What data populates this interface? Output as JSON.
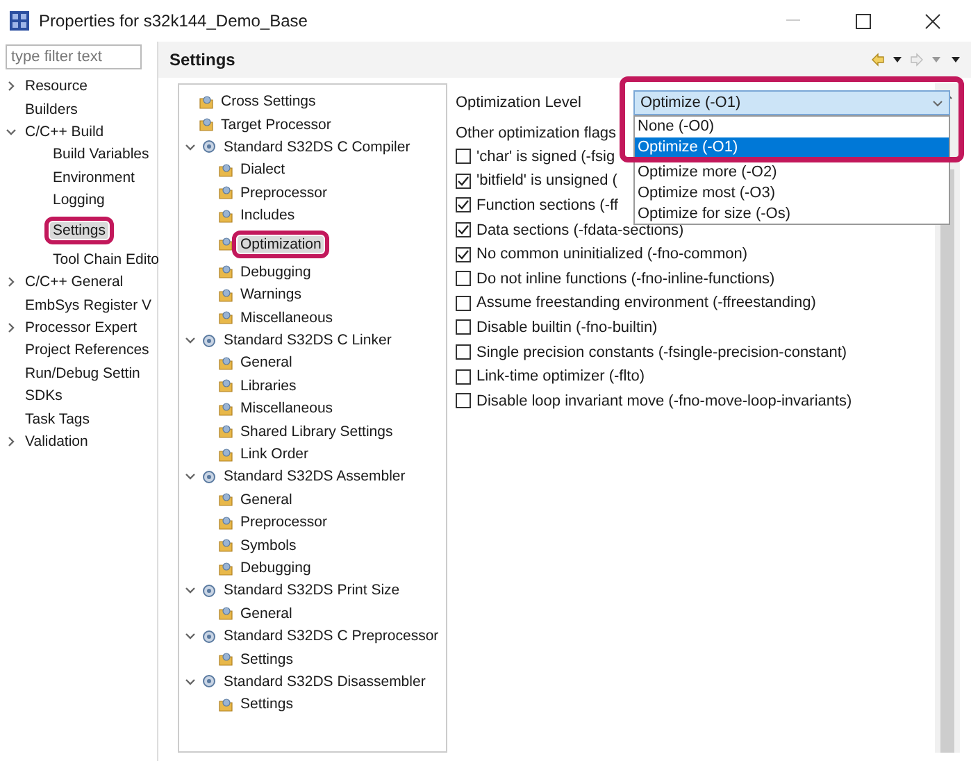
{
  "window": {
    "title": "Properties for s32k144_Demo_Base"
  },
  "filter": {
    "placeholder": "type filter text"
  },
  "sidebar": {
    "items": [
      {
        "label": "Resource",
        "expanded": false,
        "selected": false,
        "annotated": false
      },
      {
        "label": "Builders",
        "selected": false,
        "annotated": false
      },
      {
        "label": "C/C++ Build",
        "expanded": true,
        "selected": false,
        "annotated": false,
        "children": [
          {
            "label": "Build Variables",
            "selected": false,
            "annotated": false
          },
          {
            "label": "Environment",
            "selected": false,
            "annotated": false
          },
          {
            "label": "Logging",
            "selected": false,
            "annotated": false
          },
          {
            "label": "Settings",
            "selected": true,
            "annotated": true
          },
          {
            "label": "Tool Chain Edito",
            "selected": false,
            "annotated": false
          }
        ]
      },
      {
        "label": "C/C++ General",
        "expanded": false,
        "selected": false,
        "annotated": false
      },
      {
        "label": "EmbSys Register V",
        "selected": false,
        "annotated": false
      },
      {
        "label": "Processor Expert",
        "expanded": false,
        "selected": false,
        "annotated": false
      },
      {
        "label": "Project References",
        "selected": false,
        "annotated": false
      },
      {
        "label": "Run/Debug Settin",
        "selected": false,
        "annotated": false
      },
      {
        "label": "SDKs",
        "selected": false,
        "annotated": false
      },
      {
        "label": "Task Tags",
        "selected": false,
        "annotated": false
      },
      {
        "label": "Validation",
        "expanded": false,
        "selected": false,
        "annotated": false
      }
    ]
  },
  "page": {
    "title": "Settings"
  },
  "tool_tree": [
    {
      "label": "Cross Settings",
      "kind": "page",
      "selected": false,
      "annotated": false
    },
    {
      "label": "Target Processor",
      "kind": "page",
      "selected": false,
      "annotated": false
    },
    {
      "label": "Standard S32DS C Compiler",
      "kind": "tool",
      "expanded": true,
      "children": [
        {
          "label": "Dialect",
          "kind": "page",
          "selected": false,
          "annotated": false
        },
        {
          "label": "Preprocessor",
          "kind": "page",
          "selected": false,
          "annotated": false
        },
        {
          "label": "Includes",
          "kind": "page",
          "selected": false,
          "annotated": false
        },
        {
          "label": "Optimization",
          "kind": "page",
          "selected": true,
          "annotated": true
        },
        {
          "label": "Debugging",
          "kind": "page",
          "selected": false,
          "annotated": false
        },
        {
          "label": "Warnings",
          "kind": "page",
          "selected": false,
          "annotated": false
        },
        {
          "label": "Miscellaneous",
          "kind": "page",
          "selected": false,
          "annotated": false
        }
      ]
    },
    {
      "label": "Standard S32DS C Linker",
      "kind": "tool",
      "expanded": true,
      "children": [
        {
          "label": "General",
          "kind": "page",
          "selected": false,
          "annotated": false
        },
        {
          "label": "Libraries",
          "kind": "page",
          "selected": false,
          "annotated": false
        },
        {
          "label": "Miscellaneous",
          "kind": "page",
          "selected": false,
          "annotated": false
        },
        {
          "label": "Shared Library Settings",
          "kind": "page",
          "selected": false,
          "annotated": false
        },
        {
          "label": "Link Order",
          "kind": "page",
          "selected": false,
          "annotated": false
        }
      ]
    },
    {
      "label": "Standard S32DS Assembler",
      "kind": "tool",
      "expanded": true,
      "children": [
        {
          "label": "General",
          "kind": "page",
          "selected": false,
          "annotated": false
        },
        {
          "label": "Preprocessor",
          "kind": "page",
          "selected": false,
          "annotated": false
        },
        {
          "label": "Symbols",
          "kind": "page",
          "selected": false,
          "annotated": false
        },
        {
          "label": "Debugging",
          "kind": "page",
          "selected": false,
          "annotated": false
        }
      ]
    },
    {
      "label": "Standard S32DS Print Size",
      "kind": "tool",
      "expanded": true,
      "children": [
        {
          "label": "General",
          "kind": "page",
          "selected": false,
          "annotated": false
        }
      ]
    },
    {
      "label": "Standard S32DS C Preprocessor",
      "kind": "tool",
      "expanded": true,
      "children": [
        {
          "label": "Settings",
          "kind": "page",
          "selected": false,
          "annotated": false
        }
      ]
    },
    {
      "label": "Standard S32DS Disassembler",
      "kind": "tool",
      "expanded": true,
      "children": [
        {
          "label": "Settings",
          "kind": "page",
          "selected": false,
          "annotated": false
        }
      ]
    }
  ],
  "optimization": {
    "level_label": "Optimization Level",
    "level_value": "Optimize (-O1)",
    "annotated": true,
    "options": [
      {
        "label": "None (-O0)",
        "selected": false
      },
      {
        "label": "Optimize (-O1)",
        "selected": true
      },
      {
        "label": "Optimize more (-O2)",
        "selected": false
      },
      {
        "label": "Optimize most (-O3)",
        "selected": false
      },
      {
        "label": "Optimize for size (-Os)",
        "selected": false
      }
    ],
    "flags_label": "Other optimization flags",
    "flags": [
      {
        "label": "'char' is signed (-fsig",
        "checked": false
      },
      {
        "label": "'bitfield' is unsigned (",
        "checked": true
      },
      {
        "label": "Function sections (-ff",
        "checked": true
      },
      {
        "label": "Data sections (-fdata-sections)",
        "checked": true
      },
      {
        "label": "No common uninitialized (-fno-common)",
        "checked": true
      },
      {
        "label": "Do not inline functions (-fno-inline-functions)",
        "checked": false
      },
      {
        "label": "Assume freestanding environment (-ffreestanding)",
        "checked": false
      },
      {
        "label": "Disable builtin (-fno-builtin)",
        "checked": false
      },
      {
        "label": "Single precision constants (-fsingle-precision-constant)",
        "checked": false
      },
      {
        "label": "Link-time optimizer (-flto)",
        "checked": false
      },
      {
        "label": "Disable loop invariant move (-fno-move-loop-invariants)",
        "checked": false
      }
    ]
  }
}
